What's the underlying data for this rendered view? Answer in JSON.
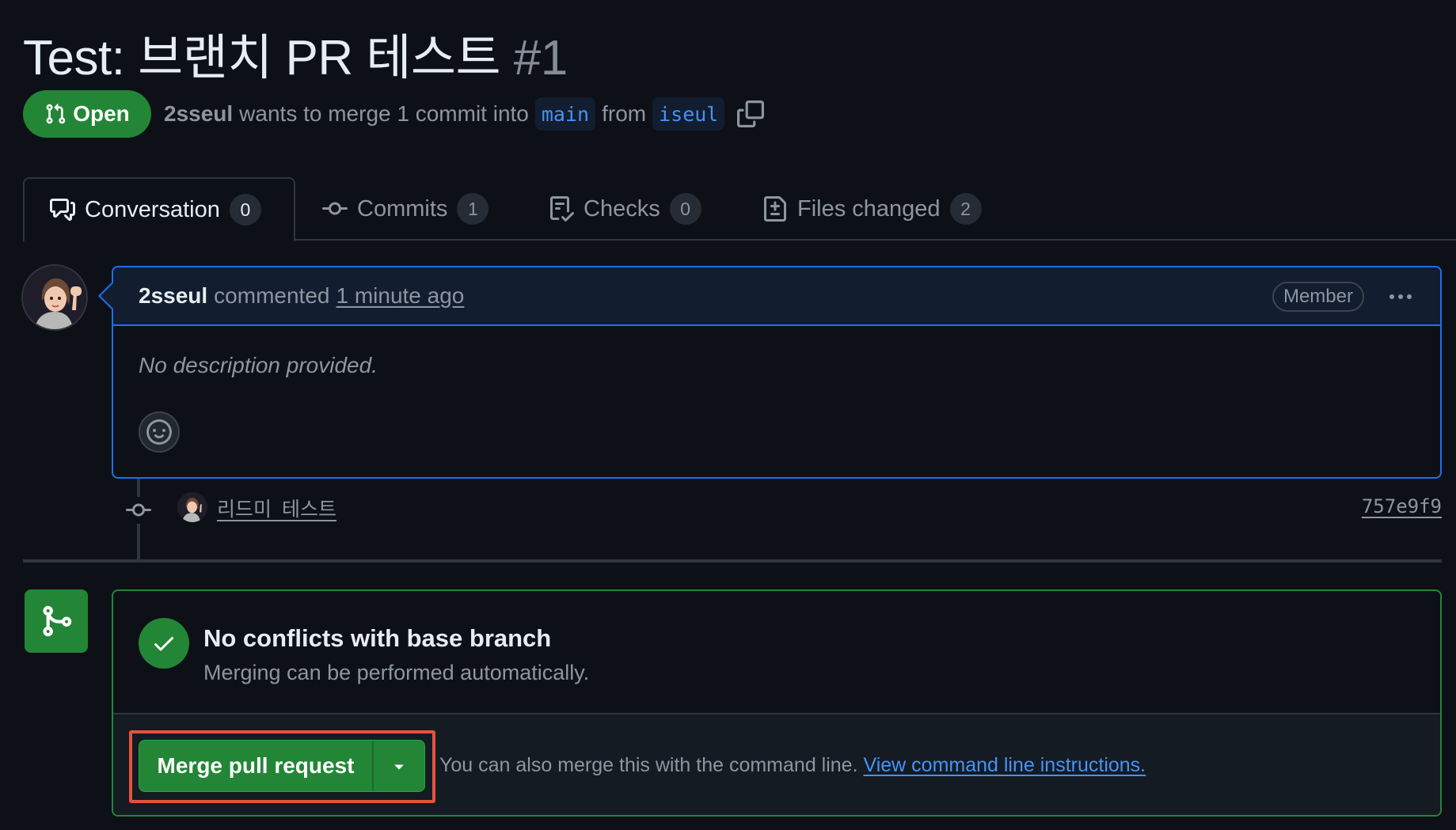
{
  "pr": {
    "title": "Test: 브랜치 PR 테스트",
    "number": "#1",
    "state": "Open",
    "author": "2sseul",
    "merge_text": "wants to merge 1 commit into",
    "base_branch": "main",
    "from_text": "from",
    "head_branch": "iseul"
  },
  "tabs": [
    {
      "label": "Conversation",
      "count": "0",
      "icon": "comment-discussion-icon"
    },
    {
      "label": "Commits",
      "count": "1",
      "icon": "git-commit-icon"
    },
    {
      "label": "Checks",
      "count": "0",
      "icon": "checklist-icon"
    },
    {
      "label": "Files changed",
      "count": "2",
      "icon": "file-diff-icon"
    }
  ],
  "comment": {
    "author": "2sseul",
    "action": "commented",
    "time": "1 minute ago",
    "role": "Member",
    "body": "No description provided."
  },
  "commit": {
    "message": "리드미 테스트",
    "sha": "757e9f9"
  },
  "merge": {
    "status_title": "No conflicts with base branch",
    "status_subtitle": "Merging can be performed automatically.",
    "button_label": "Merge pull request",
    "hint_text": "You can also merge this with the command line.",
    "hint_link": "View command line instructions."
  },
  "colors": {
    "background": "#0d1117",
    "accent_green": "#238636",
    "link_blue": "#4493f8",
    "highlight_red": "#e5533c"
  }
}
